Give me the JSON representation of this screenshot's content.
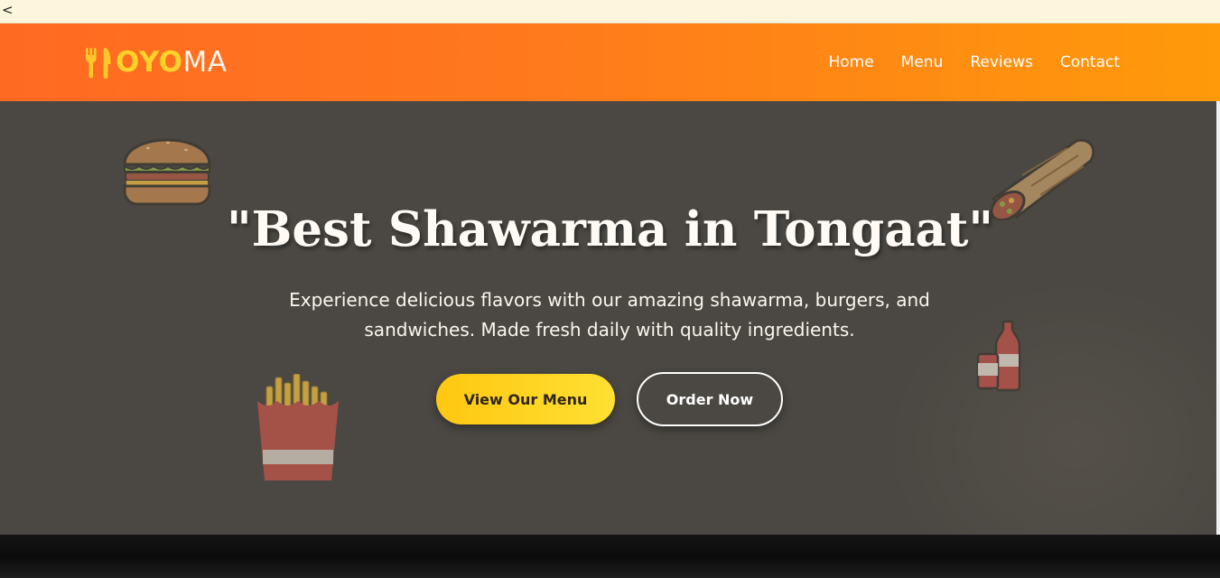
{
  "browser": {
    "back_glyph": "<"
  },
  "brand": {
    "part1": "OYO",
    "part2": "MA",
    "icon": "utensils-icon"
  },
  "nav": {
    "items": [
      "Home",
      "Menu",
      "Reviews",
      "Contact"
    ]
  },
  "hero": {
    "title": "\"Best Shawarma in Tongaat\"",
    "subtitle": "Experience delicious flavors with our amazing shawarma, burgers, and sandwiches. Made fresh daily with quality ingredients.",
    "primary_button": "View Our Menu",
    "secondary_button": "Order Now",
    "decor_icons": [
      "burger-icon",
      "shawarma-wrap-icon",
      "drinks-icon",
      "fries-icon"
    ]
  },
  "colors": {
    "nav_gradient_start": "#ff6a22",
    "nav_gradient_end": "#ff9a0a",
    "brand_accent": "#ffd12a",
    "hero_bg": "#4b4843",
    "primary_button": "#ffc711"
  }
}
